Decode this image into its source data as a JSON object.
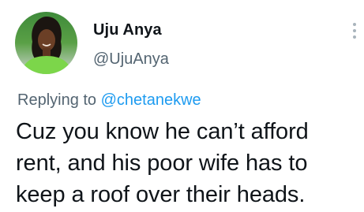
{
  "author": {
    "display_name": "Uju Anya",
    "handle": "@UjuAnya"
  },
  "reply": {
    "prefix": "Replying to ",
    "mention": "@chetanekwe"
  },
  "tweet": {
    "lines": [
      "Cuz you know he can’t afford",
      "rent, and his poor wife has to",
      "keep a roof over their heads."
    ]
  },
  "icons": {
    "more": "more-vertical-icon",
    "avatar": "profile-avatar"
  },
  "colors": {
    "text": "#0f1419",
    "secondary": "#536471",
    "link": "#1d9bf0",
    "avatar_top": "#2e7d32",
    "avatar_shirt": "#7cd64a"
  }
}
